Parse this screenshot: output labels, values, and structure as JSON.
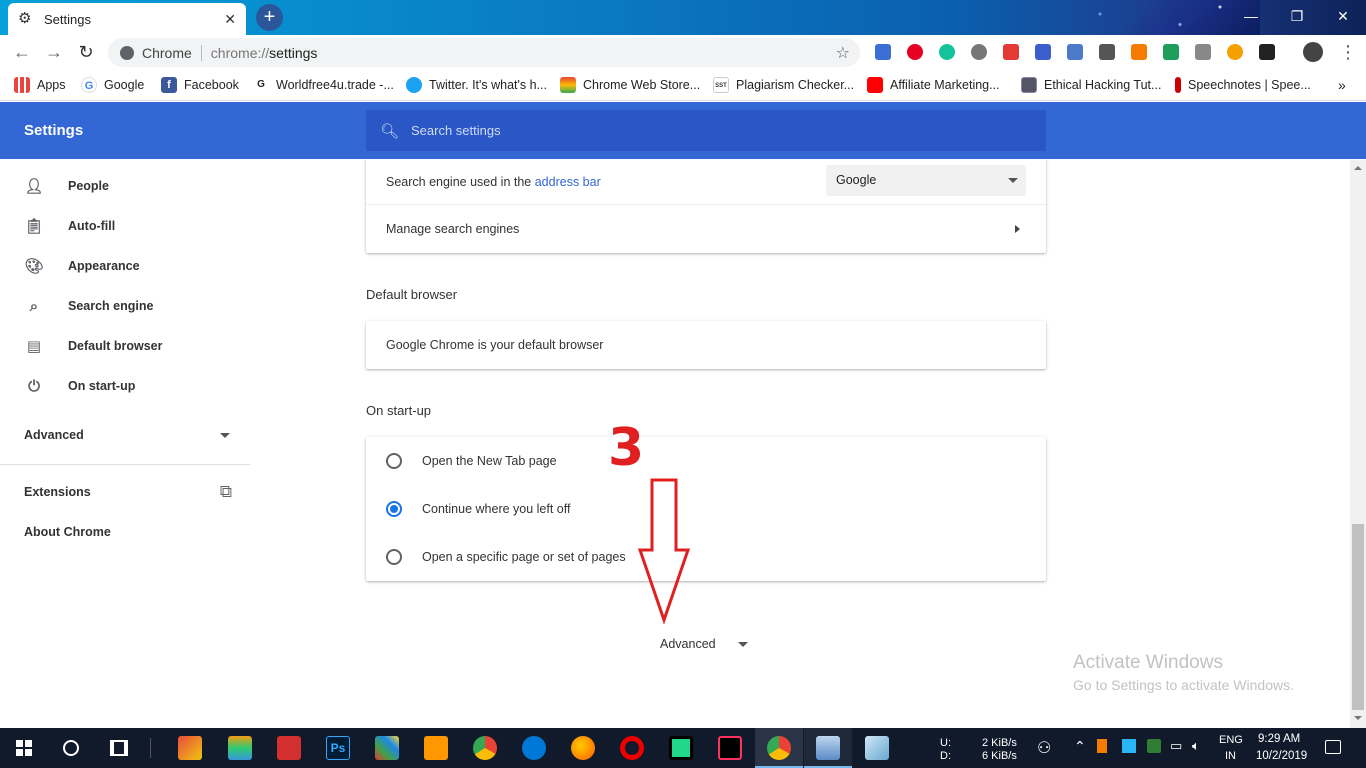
{
  "window": {
    "tab_title": "Settings",
    "new_tab_symbol": "+",
    "minimize": "—",
    "restore": "❐",
    "close": "✕"
  },
  "toolbar": {
    "omnibox_chip": "Chrome",
    "url_scheme": "chrome://",
    "url_path": "settings"
  },
  "bookmarks": [
    {
      "label": "Apps",
      "icon": "apps-grid-icon"
    },
    {
      "label": "Google",
      "icon": "google-icon"
    },
    {
      "label": "Facebook",
      "icon": "facebook-icon"
    },
    {
      "label": "Worldfree4u.trade -...",
      "icon": "g-icon"
    },
    {
      "label": "Twitter. It's what's h...",
      "icon": "twitter-icon"
    },
    {
      "label": "Chrome Web Store...",
      "icon": "webstore-icon"
    },
    {
      "label": "Plagiarism Checker...",
      "icon": "sst-icon"
    },
    {
      "label": "Affiliate Marketing...",
      "icon": "youtube-icon"
    },
    {
      "label": "Ethical Hacking Tut...",
      "icon": "site-icon"
    },
    {
      "label": "Speechnotes | Spee...",
      "icon": "mic-icon"
    }
  ],
  "bookmark_fav_text": {
    "google": "G",
    "facebook": "f",
    "g": "G",
    "sst": "SST"
  },
  "settings": {
    "title": "Settings",
    "search_placeholder": "Search settings"
  },
  "sidebar": {
    "items": [
      {
        "label": "People",
        "icon": "person-icon"
      },
      {
        "label": "Auto-fill",
        "icon": "clipboard-icon"
      },
      {
        "label": "Appearance",
        "icon": "palette-icon"
      },
      {
        "label": "Search engine",
        "icon": "search-icon"
      },
      {
        "label": "Default browser",
        "icon": "browser-icon"
      },
      {
        "label": "On start-up",
        "icon": "power-icon"
      }
    ],
    "advanced": "Advanced",
    "extensions": "Extensions",
    "about": "About Chrome"
  },
  "search_engine": {
    "label_prefix": "Search engine used in the ",
    "label_link": "address bar",
    "selected": "Google",
    "manage": "Manage search engines"
  },
  "default_browser": {
    "section_title": "Default browser",
    "status": "Google Chrome is your default browser"
  },
  "startup": {
    "section_title": "On start-up",
    "options": [
      {
        "label": "Open the New Tab page",
        "checked": false
      },
      {
        "label": "Continue where you left off",
        "checked": true
      },
      {
        "label": "Open a specific page or set of pages",
        "checked": false
      }
    ]
  },
  "advanced_toggle": "Advanced",
  "annotation": {
    "step_number": "3",
    "color": "#e02020"
  },
  "watermark": {
    "line1": "Activate Windows",
    "line2": "Go to Settings to activate Windows."
  },
  "taskbar": {
    "net_up_label": "U:",
    "net_down_label": "D:",
    "net_up": "2 KiB/s",
    "net_down": "6 KiB/s",
    "lang": "ENG",
    "region": "IN",
    "time": "9:29 AM",
    "date": "10/2/2019"
  },
  "colors": {
    "accent": "#3367d6",
    "link": "#3367d6",
    "radio": "#1a73e8"
  }
}
